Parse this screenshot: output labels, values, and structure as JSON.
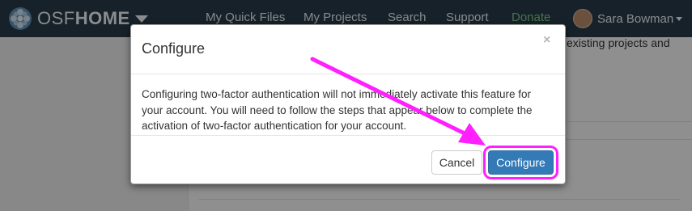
{
  "navbar": {
    "brand_osf": "OSF",
    "brand_home": "HOME",
    "links": [
      "My Quick Files",
      "My Projects",
      "Search",
      "Support",
      "Donate"
    ],
    "user_name": "Sara Bowman"
  },
  "background": {
    "text_snippet": "existing projects and"
  },
  "modal": {
    "title": "Configure",
    "close_glyph": "×",
    "body": "Configuring two-factor authentication will not immediately activate this feature for your account. You will need to follow the steps that appear below to complete the activation of two-factor authentication for your account.",
    "cancel_label": "Cancel",
    "configure_label": "Configure"
  },
  "colors": {
    "navbar": "#263947",
    "primary": "#337ab7",
    "highlight": "#ff1fff",
    "donate": "#7ec883"
  },
  "icons": [
    "osf-logo-icon",
    "caret-down-icon",
    "avatar",
    "close-icon",
    "annotation-arrow"
  ]
}
